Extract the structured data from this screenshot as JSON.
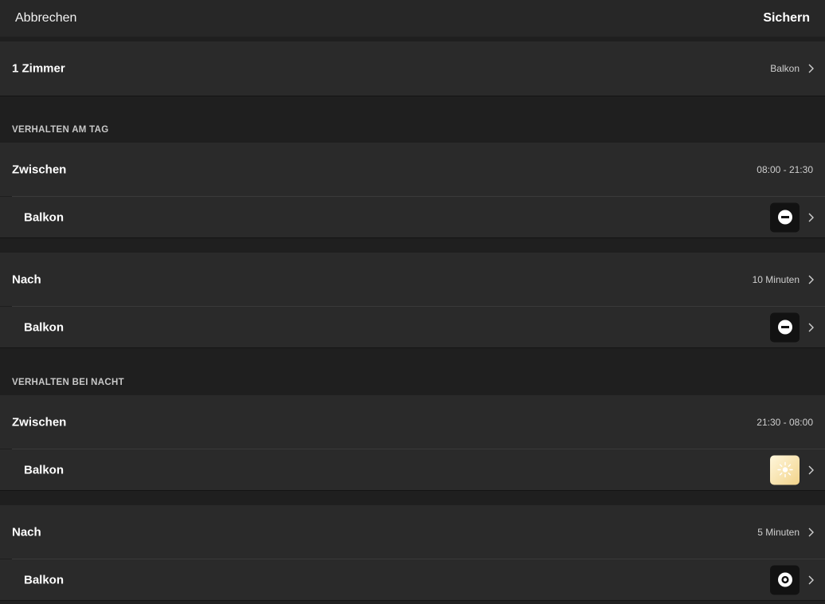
{
  "topbar": {
    "cancel_label": "Abbrechen",
    "save_label": "Sichern"
  },
  "room_row": {
    "label": "1 Zimmer",
    "value": "Balkon"
  },
  "day": {
    "header": "VERHALTEN AM TAG",
    "between": {
      "label": "Zwischen",
      "value": "08:00 - 21:30"
    },
    "between_room": {
      "label": "Balkon",
      "icon": "off-minus-icon"
    },
    "after": {
      "label": "Nach",
      "value": "10 Minuten"
    },
    "after_room": {
      "label": "Balkon",
      "icon": "off-minus-icon"
    }
  },
  "night": {
    "header": "VERHALTEN BEI NACHT",
    "between": {
      "label": "Zwischen",
      "value": "21:30 - 08:00"
    },
    "between_room": {
      "label": "Balkon",
      "icon": "sun-icon"
    },
    "after": {
      "label": "Nach",
      "value": "5 Minuten"
    },
    "after_room": {
      "label": "Balkon",
      "icon": "ring-icon"
    }
  },
  "colors": {
    "background": "#1f1f1f",
    "row": "#2a2a2a",
    "scene_dark": "#121212",
    "sun_gradient_start": "#fff7dc",
    "sun_gradient_end": "#f2d38a"
  }
}
